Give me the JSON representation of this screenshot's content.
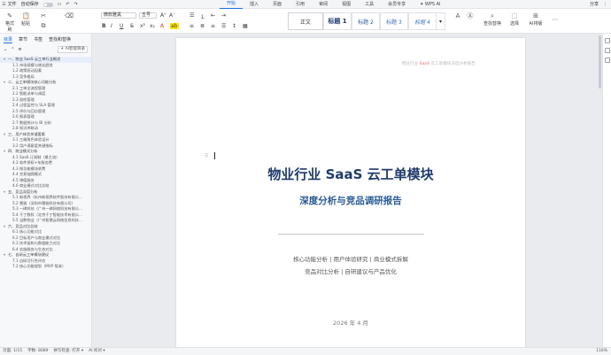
{
  "menubar": {
    "file": "三 文件",
    "autosave": "自动保存",
    "tabs": [
      "开始",
      "插入",
      "页面",
      "引用",
      "审阅",
      "视图",
      "工具",
      "会员专享",
      "✦ WPS AI"
    ],
    "active_tab": "开始",
    "right": [
      "分享",
      "⋮"
    ]
  },
  "toolbar": {
    "format_painter": "格式刷",
    "paste": "粘贴",
    "font_name": "微软雅黑",
    "font_size": "五号",
    "style_normal": "正文",
    "style_h1": "标题 1",
    "style_h2": "标题 2",
    "style_h3": "标题 3",
    "style_h4": "标题 4",
    "find_replace": "查找替换",
    "select": "选择",
    "ai_layout": "AI排版"
  },
  "sidebar": {
    "tabs": [
      "目录",
      "章节",
      "书签",
      "查找和替换"
    ],
    "active_tab": "目录",
    "ai_button": "✦ AI智能目录",
    "outline": [
      {
        "level": 1,
        "label": "一、物业 SaaS 云工单行业概述"
      },
      {
        "level": 2,
        "label": "1.1 市场规模与增长趋势"
      },
      {
        "level": 2,
        "label": "1.2 政策驱动因素"
      },
      {
        "level": 2,
        "label": "1.3 竞争格局"
      },
      {
        "level": 1,
        "label": "二、云工单模块核心功能分析"
      },
      {
        "level": 2,
        "label": "2.1 工单全流程管理"
      },
      {
        "level": 2,
        "label": "2.2 智能派单与调度"
      },
      {
        "level": 2,
        "label": "2.3 巡检管理"
      },
      {
        "level": 2,
        "label": "2.4 过程监控与 SLA 管理"
      },
      {
        "level": 2,
        "label": "2.5 评价与回访管理"
      },
      {
        "level": 2,
        "label": "2.6 报表管理"
      },
      {
        "level": 2,
        "label": "2.7 数据统计与 BI 分析"
      },
      {
        "level": 2,
        "label": "2.8 知识库联动"
      },
      {
        "level": 1,
        "label": "三、用户体验关键要素"
      },
      {
        "level": 2,
        "label": "3.1 三端角色体验设计"
      },
      {
        "level": 2,
        "label": "3.2 用户满意度关键指标"
      },
      {
        "level": 1,
        "label": "四、商业模式分析"
      },
      {
        "level": 2,
        "label": "4.1 SaaS 订阅制（最主流）"
      },
      {
        "level": 2,
        "label": "4.2 软件授权+年服务费"
      },
      {
        "level": 2,
        "label": "4.3 按功能模块收费"
      },
      {
        "level": 2,
        "label": "4.4 交易抽佣模式"
      },
      {
        "level": 2,
        "label": "4.5 增值服务"
      },
      {
        "level": 2,
        "label": "4.6 商业模式对比总结"
      },
      {
        "level": 1,
        "label": "五、竞品深度分析"
      },
      {
        "level": 2,
        "label": "5.1 新视界（杭州新视界软件股份有限公..."
      },
      {
        "level": 2,
        "label": "5.2 慧雅（深圳市慧雅科技有限公司）"
      },
      {
        "level": 2,
        "label": "5.3 一碑科技（广州一碑网络科技有限公..."
      },
      {
        "level": 2,
        "label": "5.4 千丁数科（北京千丁智能技术有限公..."
      },
      {
        "level": 2,
        "label": "5.5 当数物业（广州智慧云网络信息科技..."
      },
      {
        "level": 1,
        "label": "六、竞品对比总结"
      },
      {
        "level": 2,
        "label": "6.1 核心功能对比"
      },
      {
        "level": 2,
        "label": "6.2 目标用户与商业模式对比"
      },
      {
        "level": 2,
        "label": "6.3 技术架构与数据能力对比"
      },
      {
        "level": 2,
        "label": "6.4 实施服务与生态对比"
      },
      {
        "level": 1,
        "label": "七、自研云工单模块建议"
      },
      {
        "level": 2,
        "label": "7.1 自研可行性评估"
      },
      {
        "level": 2,
        "label": "7.2 核心功能规划（MVP 版本）"
      }
    ]
  },
  "document": {
    "header_prefix": "物业行业 ",
    "header_highlight": "SaaS",
    "header_suffix": " 云工单模块深度分析报告",
    "title": "物业行业 SaaS 云工单模块",
    "subtitle": "深度分析与竞品调研报告",
    "line1": "核心功能分析 | 用户体验研究 | 商业模式拆解",
    "line2": "竞品对比分析 | 自研建议与产品优化",
    "date": "2026 年 4 月"
  },
  "statusbar": {
    "page": "页面: 1/15",
    "words": "字数: 8089",
    "spell": "拼写检查: 打开 ▾",
    "ai": "AI 校对 ▾",
    "zoom": "116%"
  }
}
